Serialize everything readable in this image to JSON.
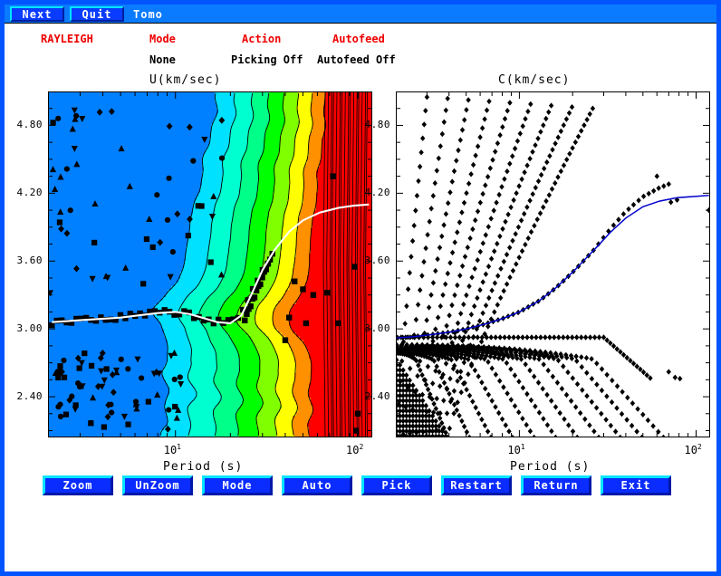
{
  "window": {
    "border_color": "#0055ff",
    "background": "#ffffff"
  },
  "menubar": {
    "background": "#0a7bff",
    "buttons": [
      {
        "name": "next",
        "label": "Next"
      },
      {
        "name": "quit",
        "label": "Quit"
      }
    ],
    "app_label": "Tomo"
  },
  "header": {
    "wave_type": "RAYLEIGH",
    "labels": {
      "mode": "Mode",
      "action": "Action",
      "autofeed": "Autofeed"
    },
    "values": {
      "mode": "None",
      "action": "Picking Off",
      "autofeed": "Autofeed Off"
    },
    "label_color": "#ee0000",
    "value_color": "#000000"
  },
  "axis_common": {
    "xlabel": "Period (s)",
    "xscale": "log",
    "xlim": [
      2.0,
      120.0
    ],
    "ylim": [
      2.04,
      5.1
    ],
    "yticks": [
      "4.80",
      "4.20",
      "3.60",
      "3.00",
      "2.40"
    ],
    "ytick_values": [
      4.8,
      4.2,
      3.6,
      3.0,
      2.4
    ],
    "xticks_labeled": [
      {
        "value": 10,
        "label": "10",
        "exp": "1"
      },
      {
        "value": 100,
        "label": "10",
        "exp": "2"
      }
    ]
  },
  "chart_data": [
    {
      "id": "left-panel",
      "type": "heatmap",
      "title": "U(km/sec)",
      "xlabel": "Period (s)",
      "ylabel": "U(km/sec)",
      "xscale": "log",
      "xlim": [
        2.0,
        120.0
      ],
      "ylim": [
        2.04,
        5.1
      ],
      "grid": false,
      "description": "Filled contour dispersion image (group velocity) with picked observations and a white fitted dispersion curve.",
      "colorbands": [
        {
          "name": "deep-blue",
          "color": "#0080ff"
        },
        {
          "name": "cyan",
          "color": "#00e0ff"
        },
        {
          "name": "aqua",
          "color": "#00ffd0"
        },
        {
          "name": "spring",
          "color": "#00ff88"
        },
        {
          "name": "green",
          "color": "#00ff00"
        },
        {
          "name": "lime",
          "color": "#80ff00"
        },
        {
          "name": "yellow",
          "color": "#ffff00"
        },
        {
          "name": "orange",
          "color": "#ff9000"
        },
        {
          "name": "red",
          "color": "#ff0000"
        }
      ],
      "white_curve": {
        "name": "picked-dispersion-curve",
        "color": "#ffffff",
        "x": [
          2.1,
          2.6,
          3.2,
          4.0,
          5.0,
          6.3,
          8.0,
          10.0,
          12.0,
          14.0,
          17.0,
          20.0,
          23.0,
          26.0,
          30.0,
          35.0,
          42.0,
          50.0,
          62.0,
          78.0,
          95.0,
          115.0
        ],
        "y": [
          3.06,
          3.07,
          3.08,
          3.09,
          3.1,
          3.12,
          3.14,
          3.15,
          3.13,
          3.1,
          3.06,
          3.05,
          3.12,
          3.3,
          3.52,
          3.7,
          3.86,
          3.96,
          4.03,
          4.07,
          4.09,
          4.1
        ]
      },
      "observations": {
        "name": "observed-picks",
        "color": "#000000",
        "marker_types": [
          "square",
          "circle",
          "diamond",
          "triangle-up",
          "triangle-down"
        ],
        "count_approx": 190,
        "clusters": [
          {
            "region": "upper-left-scatter",
            "x_range": [
              2.0,
              20.0
            ],
            "y_range": [
              3.3,
              4.95
            ]
          },
          {
            "region": "central-ridge",
            "x_range": [
              2.0,
              40.0
            ],
            "y_range": [
              2.95,
              3.35
            ]
          },
          {
            "region": "lower-left-scatter",
            "x_range": [
              2.0,
              12.0
            ],
            "y_range": [
              2.05,
              2.75
            ]
          },
          {
            "region": "right-sparse",
            "x_range": [
              35.0,
              90.0
            ],
            "y_range": [
              3.0,
              4.4
            ]
          }
        ]
      }
    },
    {
      "id": "right-panel",
      "type": "scatter",
      "title": "C(km/sec)",
      "xlabel": "Period (s)",
      "ylabel": "C(km/sec)",
      "xscale": "log",
      "xlim": [
        2.0,
        120.0
      ],
      "ylim": [
        2.04,
        5.1
      ],
      "grid": false,
      "background": "#ffffff",
      "description": "Phase velocity dispersion branches: families of modal curves drawn as black diamond markers, with one selected branch highlighted by a blue fitted curve.",
      "branch_marker": {
        "shape": "diamond",
        "color": "#000000"
      },
      "fitted_curve": {
        "name": "selected-phase-branch",
        "color": "#0000cc",
        "x": [
          2.0,
          2.5,
          3.2,
          4.0,
          5.0,
          6.3,
          8.0,
          10.0,
          13.0,
          16.0,
          20.0,
          24.0,
          28.0,
          33.0,
          40.0,
          50.0,
          62.0,
          78.0,
          95.0,
          118.0
        ],
        "y": [
          2.92,
          2.93,
          2.95,
          2.97,
          3.0,
          3.04,
          3.09,
          3.15,
          3.25,
          3.36,
          3.5,
          3.63,
          3.74,
          3.86,
          3.98,
          4.08,
          4.13,
          4.16,
          4.17,
          4.18
        ]
      },
      "branches_ascending": 9,
      "branches_descending": 11
    }
  ],
  "buttonbar": {
    "buttons": [
      {
        "name": "zoom",
        "label": "Zoom"
      },
      {
        "name": "unzoom",
        "label": "UnZoom"
      },
      {
        "name": "mode",
        "label": "Mode"
      },
      {
        "name": "auto",
        "label": "Auto"
      },
      {
        "name": "pick",
        "label": "Pick"
      },
      {
        "name": "restart",
        "label": "Restart"
      },
      {
        "name": "return",
        "label": "Return"
      },
      {
        "name": "exit",
        "label": "Exit"
      }
    ]
  }
}
